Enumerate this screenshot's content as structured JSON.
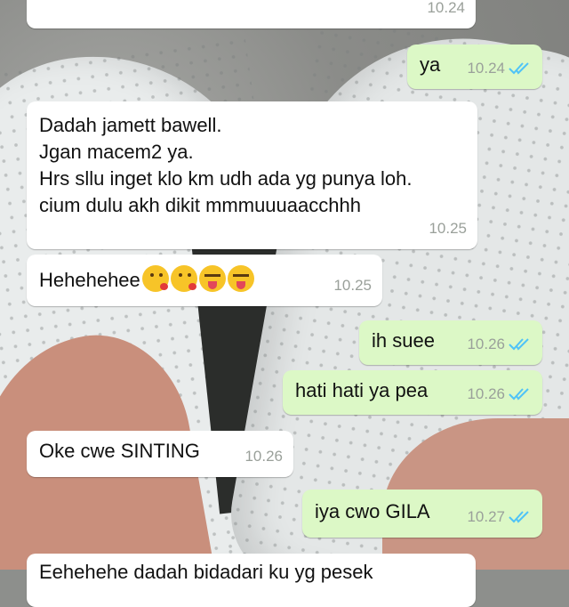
{
  "messages": [
    {
      "id": "m0",
      "dir": "in",
      "text": "",
      "time": "10.24",
      "ticks": false
    },
    {
      "id": "m1",
      "dir": "out",
      "text": "ya",
      "time": "10.24",
      "ticks": true
    },
    {
      "id": "m2",
      "dir": "in",
      "lines": [
        "Dadah jamett bawell.",
        "Jgan macem2 ya.",
        "Hrs sllu inget klo km udh ada yg punya loh.",
        "cium dulu akh dikit mmmuuuaacchhh"
      ],
      "time": "10.25",
      "ticks": false
    },
    {
      "id": "m3",
      "dir": "in",
      "text": "Hehehehee",
      "emojis": [
        "kissing-heart-emoji",
        "kissing-heart-emoji",
        "squinting-tongue-emoji",
        "squinting-tongue-emoji"
      ],
      "time": "10.25",
      "ticks": false
    },
    {
      "id": "m4",
      "dir": "out",
      "text": "ih suee",
      "time": "10.26",
      "ticks": true
    },
    {
      "id": "m5",
      "dir": "out",
      "text": "hati hati ya pea",
      "time": "10.26",
      "ticks": true
    },
    {
      "id": "m6",
      "dir": "in",
      "text": "Oke cwe SINTING",
      "time": "10.26",
      "ticks": false
    },
    {
      "id": "m7",
      "dir": "out",
      "text": "iya cwo GILA",
      "time": "10.27",
      "ticks": true
    },
    {
      "id": "m8",
      "dir": "in",
      "text": "Eehehehe dadah bidadari ku yg pesek",
      "time": "",
      "ticks": false
    }
  ],
  "colors": {
    "incoming": "#ffffff",
    "outgoing": "#dcf8c6",
    "tick": "#4fc3f7",
    "time": "#9aa09a"
  }
}
